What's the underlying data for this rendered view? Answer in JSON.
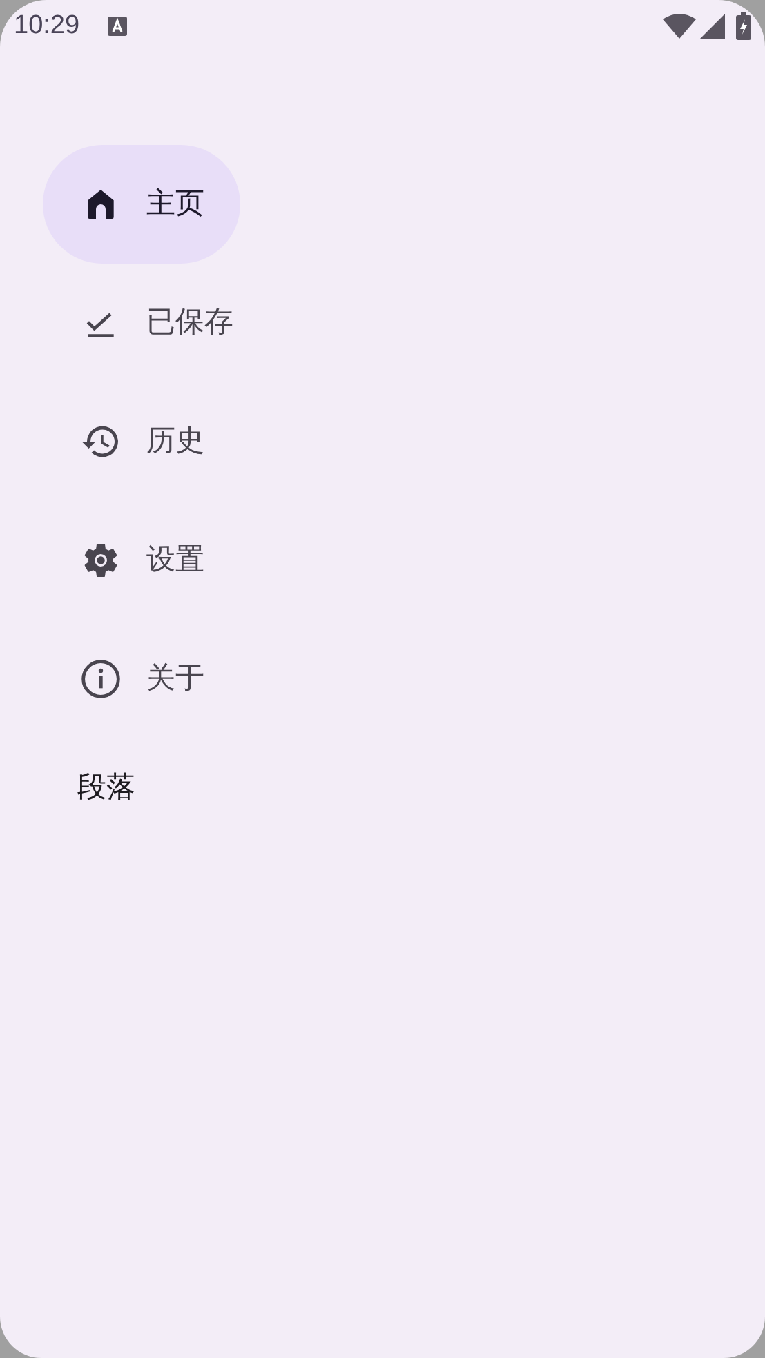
{
  "status_bar": {
    "time": "10:29"
  },
  "nav_items": [
    {
      "label": "主页",
      "selected": true
    },
    {
      "label": "已保存",
      "selected": false
    },
    {
      "label": "历史",
      "selected": false
    },
    {
      "label": "设置",
      "selected": false
    },
    {
      "label": "关于",
      "selected": false
    }
  ],
  "paragraph": "段落"
}
